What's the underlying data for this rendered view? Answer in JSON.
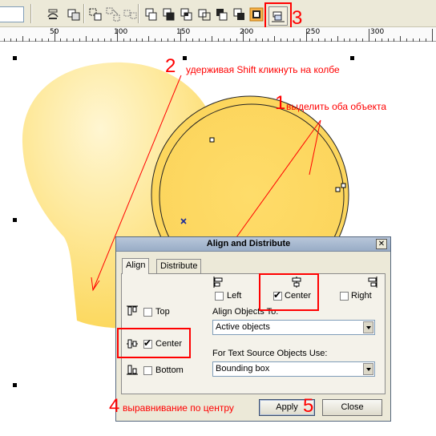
{
  "toolbar": {
    "field_value": "",
    "buttons": [
      {
        "icon": "wrap-paragraph-icon"
      },
      {
        "icon": "group-icon"
      },
      {
        "icon": "ungroup-icon"
      },
      {
        "icon": "ungroup-all-icon"
      },
      {
        "icon": "combine-icon"
      },
      {
        "icon": "weld-icon"
      },
      {
        "icon": "trim-icon"
      },
      {
        "icon": "intersect-icon"
      },
      {
        "icon": "simplify-icon"
      },
      {
        "icon": "front-minus-back-icon"
      },
      {
        "icon": "back-minus-front-icon"
      },
      {
        "icon": "create-boundary-icon"
      },
      {
        "icon": "align-distribute-icon"
      }
    ]
  },
  "ruler": {
    "labels": [
      "50",
      "100",
      "150",
      "200",
      "250",
      "300"
    ]
  },
  "annotations": {
    "step1_num": "1",
    "step1_text": "выделить оба объекта",
    "step2_num": "2",
    "step2_text": "удерживая Shift кликнуть на колбе",
    "step3_num": "3",
    "step4_num": "4",
    "step4_text": "выравнивание по центру",
    "step5_num": "5"
  },
  "dialog": {
    "title": "Align and Distribute",
    "close_glyph": "✕",
    "tabs": [
      "Align",
      "Distribute"
    ],
    "active_tab": "Align",
    "horizontal": {
      "left_label": "Left",
      "center_label": "Center",
      "right_label": "Right",
      "left_checked": false,
      "center_checked": true,
      "right_checked": false
    },
    "vertical": {
      "top_label": "Top",
      "center_label": "Center",
      "bottom_label": "Bottom",
      "top_checked": false,
      "center_checked": true,
      "bottom_checked": false
    },
    "align_to_label": "Align Objects To:",
    "align_to_value": "Active objects",
    "text_source_label": "For Text Source Objects Use:",
    "text_source_value": "Bounding box",
    "apply_label": "Apply",
    "close_label": "Close",
    "check_glyph": "✔"
  },
  "colors": {
    "annotation": "#ff0000",
    "bulb_light": "#fff3c4",
    "bulb_dark": "#fcd75c"
  }
}
